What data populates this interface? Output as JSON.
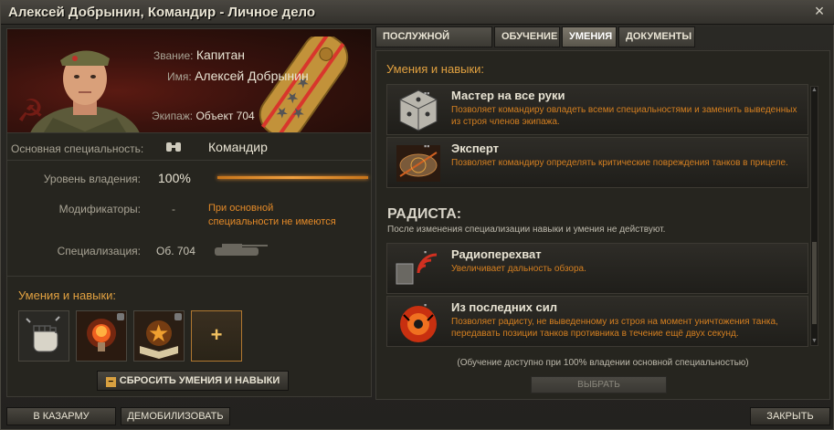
{
  "window": {
    "title": "Алексей Добрынин, Командир - Личное дело",
    "close_icon": "×"
  },
  "profile": {
    "rank_label": "Звание:",
    "rank_value": "Капитан",
    "name_label": "Имя:",
    "name_value": "Алексей Добрынин",
    "crew_label": "Экипаж:",
    "crew_value": "Объект 704"
  },
  "details": {
    "specialty_label": "Основная специальность:",
    "specialty_value": "Командир",
    "mastery_label": "Уровень владения:",
    "mastery_value": "100%",
    "mastery_fraction": 1.0,
    "modifiers_label": "Модификаторы:",
    "modifiers_dash": "-",
    "modifiers_text": "При основной специальности не имеются",
    "specialization_label": "Специализация:",
    "specialization_value": "Об. 704"
  },
  "left_skills": {
    "title": "Умения и навыки:",
    "slots": [
      "fist-icon",
      "lightbulb-icon",
      "book-star-icon",
      "plus-icon"
    ],
    "plus_label": "+",
    "reset_label": "СБРОСИТЬ УМЕНИЯ И НАВЫКИ",
    "reset_icon": "−"
  },
  "tabs": [
    {
      "label": "ПОСЛУЖНОЙ СПИСОК",
      "active": false
    },
    {
      "label": "ОБУЧЕНИЕ",
      "active": false
    },
    {
      "label": "УМЕНИЯ",
      "active": true
    },
    {
      "label": "ДОКУМЕНТЫ",
      "active": false
    }
  ],
  "right": {
    "heading": "Умения и навыки:",
    "commander_skills": [
      {
        "name": "Мастер на все руки",
        "desc": "Позволяет командиру овладеть всеми специальностями и заменить выведенных из строя членов экипажа.",
        "icon": "dice-icon"
      },
      {
        "name": "Эксперт",
        "desc": "Позволяет командиру определять критические повреждения танков в прицеле.",
        "icon": "expert-icon"
      }
    ],
    "section_title": "РАДИСТА:",
    "section_note": "После изменения специализации навыки и умения не действуют.",
    "radio_skills": [
      {
        "name": "Радиоперехват",
        "desc": "Увеличивает дальность обзора.",
        "icon": "radio-intercept-icon"
      },
      {
        "name": "Из последних сил",
        "desc": "Позволяет радисту, не выведенному из строя на момент уничтожения танка, передавать позиции танков противника в течение ещё двух секунд.",
        "icon": "last-effort-icon"
      }
    ],
    "train_note": "(Обучение доступно при 100% владении основной специальностью)",
    "select_label": "ВЫБРАТЬ"
  },
  "bottom": {
    "barracks_label": "В КАЗАРМУ",
    "demobilize_label": "ДЕМОБИЛИЗОВАТЬ",
    "close_label": "ЗАКРЫТЬ"
  },
  "colors": {
    "accent": "#e0a040",
    "desc": "#d47f20",
    "bar": "#f0a040"
  }
}
